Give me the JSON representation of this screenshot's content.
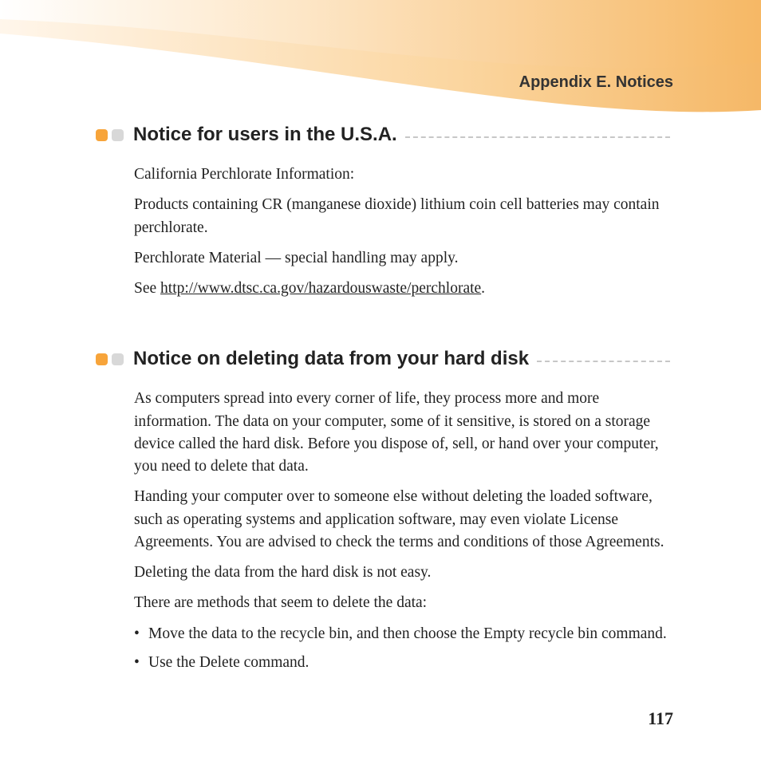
{
  "header": {
    "appendix_title": "Appendix E. Notices"
  },
  "sections": [
    {
      "heading": "Notice for users in the U.S.A.",
      "paragraphs": [
        "California Perchlorate Information:",
        "Products containing CR (manganese dioxide) lithium coin cell batteries may contain perchlorate.",
        "Perchlorate Material — special handling may apply."
      ],
      "see_prefix": "See ",
      "link": "http://www.dtsc.ca.gov/hazardouswaste/perchlorate",
      "see_suffix": "."
    },
    {
      "heading": "Notice on deleting data from your hard disk",
      "paragraphs": [
        "As computers spread into every corner of life, they process more and more information. The data on your computer, some of it sensitive, is stored on a storage device called the hard disk. Before you dispose of, sell, or hand over your computer, you need to delete that data.",
        "Handing your computer over to someone else without deleting the loaded software, such as operating systems and application software, may even violate License Agreements. You are advised to check the terms and conditions of those Agreements.",
        "Deleting the data from the hard disk is not easy.",
        "There are methods that seem to delete the data:"
      ],
      "bullets": [
        "Move the data to the recycle bin, and then choose the Empty recycle bin command.",
        "Use the Delete command."
      ]
    }
  ],
  "page_number": "117"
}
